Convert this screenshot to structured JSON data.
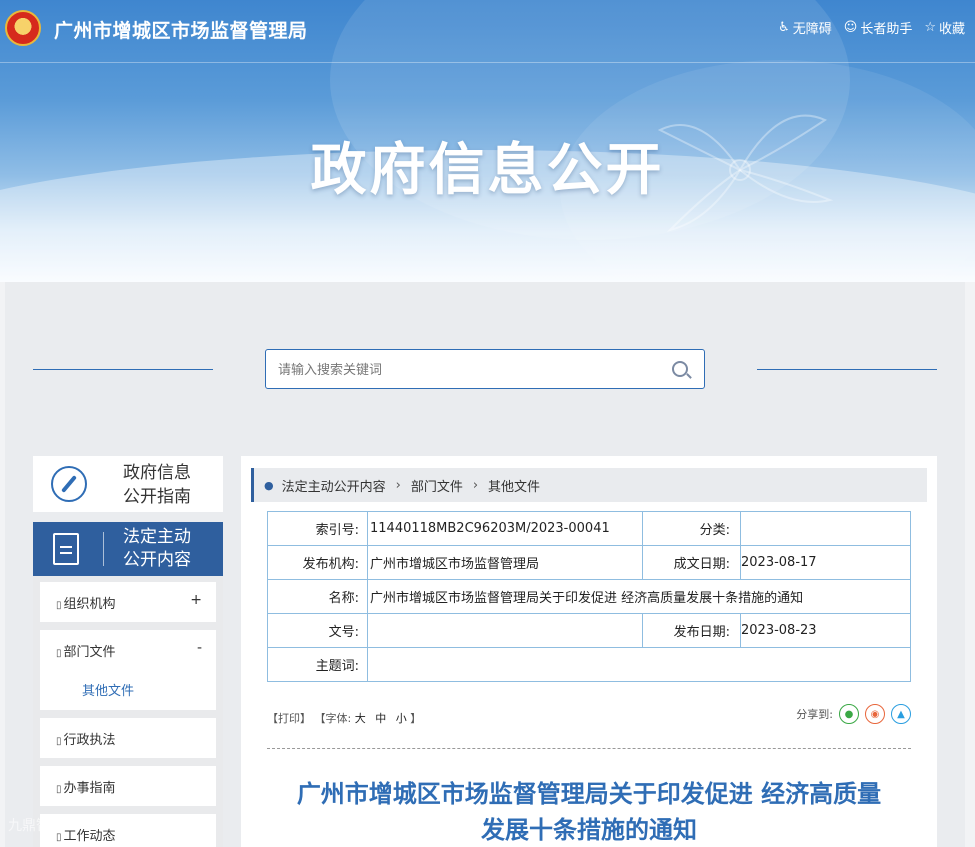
{
  "header": {
    "site_title": "广州市增城区市场监督管理局",
    "links": [
      {
        "icon": "accessibility-icon",
        "label": "无障碍"
      },
      {
        "icon": "elderly-icon",
        "label": "长者助手"
      },
      {
        "icon": "star-icon",
        "label": "收藏"
      }
    ],
    "banner_title": "政府信息公开"
  },
  "search": {
    "placeholder": "请输入搜索关键词"
  },
  "sidebar": {
    "guide_label_1": "政府信息",
    "guide_label_2": "公开指南",
    "active_label_1": "法定主动",
    "active_label_2": "公开内容",
    "items": [
      {
        "label": "组织机构",
        "toggle": "+"
      },
      {
        "label": "部门文件",
        "toggle": "-",
        "sub": "其他文件"
      },
      {
        "label": "行政执法"
      },
      {
        "label": "办事指南"
      },
      {
        "label": "工作动态"
      }
    ]
  },
  "breadcrumb": [
    "法定主动公开内容",
    "部门文件",
    "其他文件"
  ],
  "meta": {
    "index_label": "索引号:",
    "index_value": "11440118MB2C96203M/2023-00041",
    "category_label": "分类:",
    "category_value": "",
    "publisher_label": "发布机构:",
    "publisher_value": "广州市增城区市场监督管理局",
    "created_label": "成文日期:",
    "created_value": "2023-08-17",
    "name_label": "名称:",
    "name_value": "广州市增城区市场监督管理局关于印发促进 经济高质量发展十条措施的通知",
    "docno_label": "文号:",
    "docno_value": "",
    "published_label": "发布日期:",
    "published_value": "2023-08-23",
    "subject_label": "主题词:",
    "subject_value": ""
  },
  "tools": {
    "print": "【打印】",
    "font_prefix": "【字体:",
    "font_large": "大",
    "font_medium": "中",
    "font_small": "小",
    "font_suffix": "】",
    "share_label": "分享到:"
  },
  "article": {
    "title_line1": "广州市增城区市场监督管理局关于印发促进 经济高质量",
    "title_line2": "发展十条措施的通知"
  },
  "watermark": "九鼎智慧"
}
